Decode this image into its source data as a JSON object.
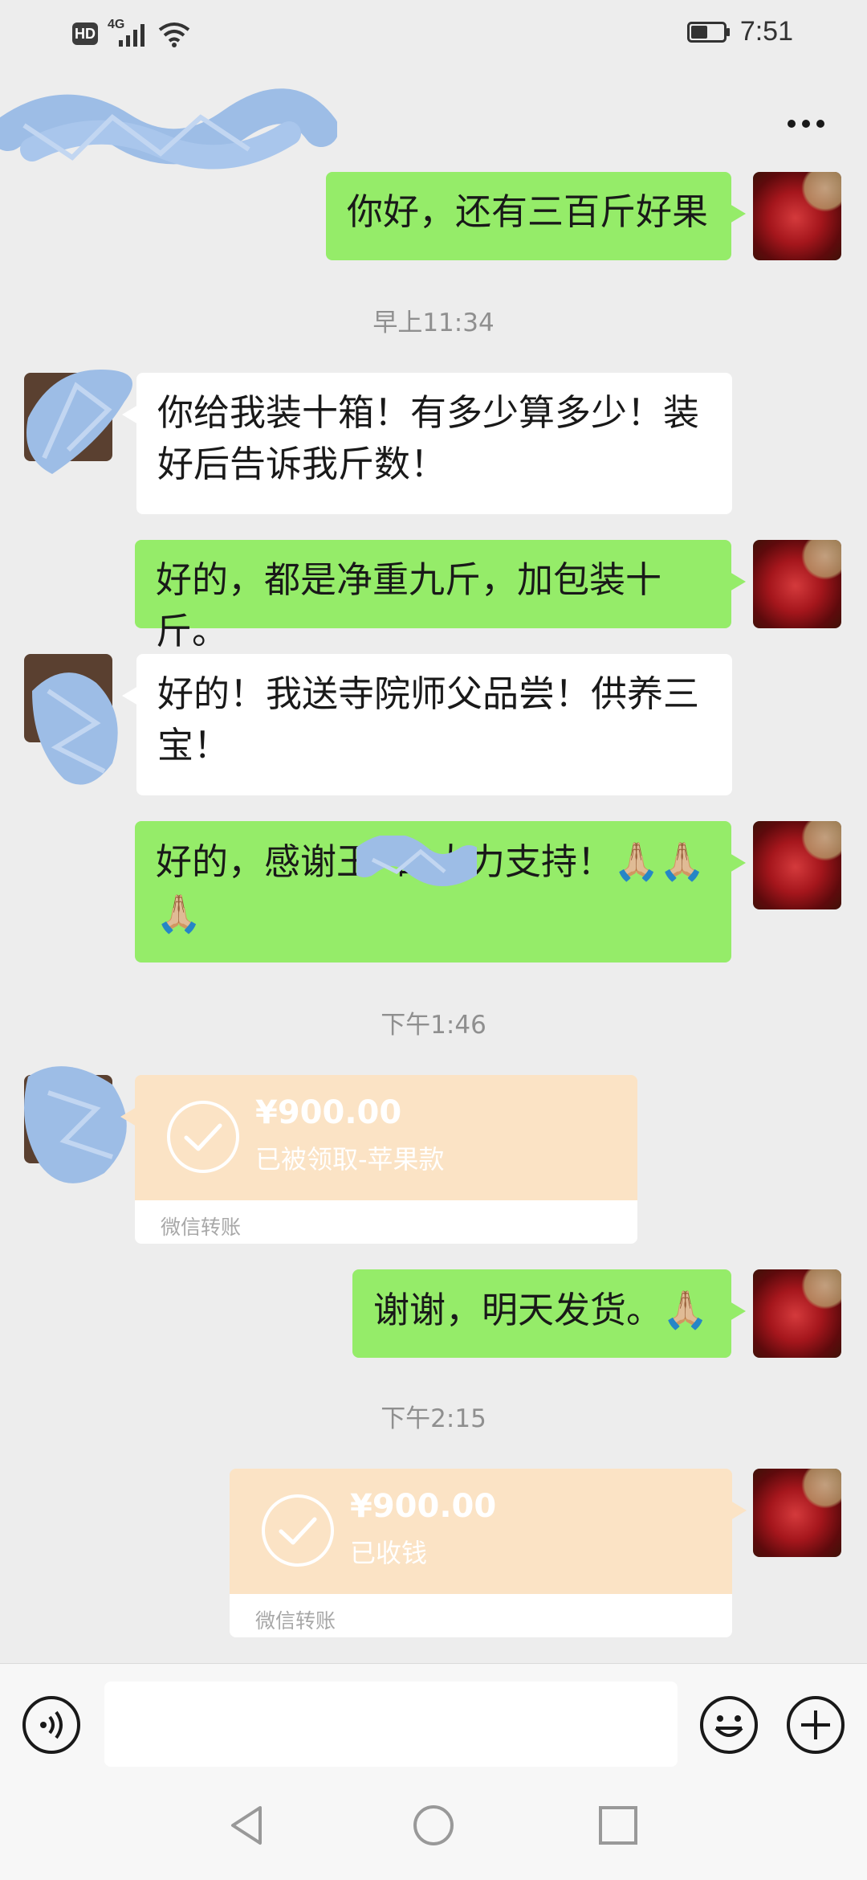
{
  "status_bar": {
    "hd_badge": "HD",
    "network": "4G",
    "time": "7:51",
    "icons": [
      "hd-icon",
      "signal-icon",
      "wifi-icon",
      "battery-icon"
    ]
  },
  "header": {
    "contact_name_redacted": true,
    "more_icon": "more-icon"
  },
  "messages": [
    {
      "side": "self",
      "type": "text",
      "text": "你好，还有三百斤好果"
    },
    {
      "side": "system",
      "type": "time",
      "text": "早上11:34"
    },
    {
      "side": "other",
      "type": "text",
      "line1": "你给我装十箱！有多少算多少！装",
      "line2": "好后告诉我斤数！"
    },
    {
      "side": "self",
      "type": "text",
      "text": "好的，都是净重九斤，加包装十斤。"
    },
    {
      "side": "other",
      "type": "text",
      "line1": "好的！我送寺院师父品尝！供养三",
      "line2": "宝！"
    },
    {
      "side": "self",
      "type": "text",
      "line1_prefix": "好的，感谢王",
      "line1_suffix": "的大力支持！",
      "emoji": "🙏🏼🙏🏼",
      "line2_emoji": "🙏🏼"
    },
    {
      "side": "system",
      "type": "time",
      "text": "下午1:46"
    },
    {
      "side": "other",
      "type": "transfer",
      "amount": "¥900.00",
      "note": "已被领取-苹果款",
      "footer": "微信转账"
    },
    {
      "side": "self",
      "type": "text",
      "text": "谢谢，明天发货。",
      "emoji": "🙏🏼"
    },
    {
      "side": "system",
      "type": "time",
      "text": "下午2:15"
    },
    {
      "side": "self",
      "type": "transfer",
      "amount": "¥900.00",
      "note": "已收钱",
      "footer": "微信转账"
    }
  ],
  "input_bar": {
    "value": "",
    "icons": [
      "voice-icon",
      "emoji-icon",
      "plus-icon"
    ]
  },
  "nav_bar": {
    "icons": [
      "back-icon",
      "home-icon",
      "recents-icon"
    ]
  },
  "colors": {
    "background": "#ededed",
    "self_bubble": "#95ec69",
    "other_bubble": "#ffffff",
    "transfer_card": "#fbe3c5",
    "timestamp_text": "#8f8f8f",
    "redaction": "#9dbde6"
  }
}
